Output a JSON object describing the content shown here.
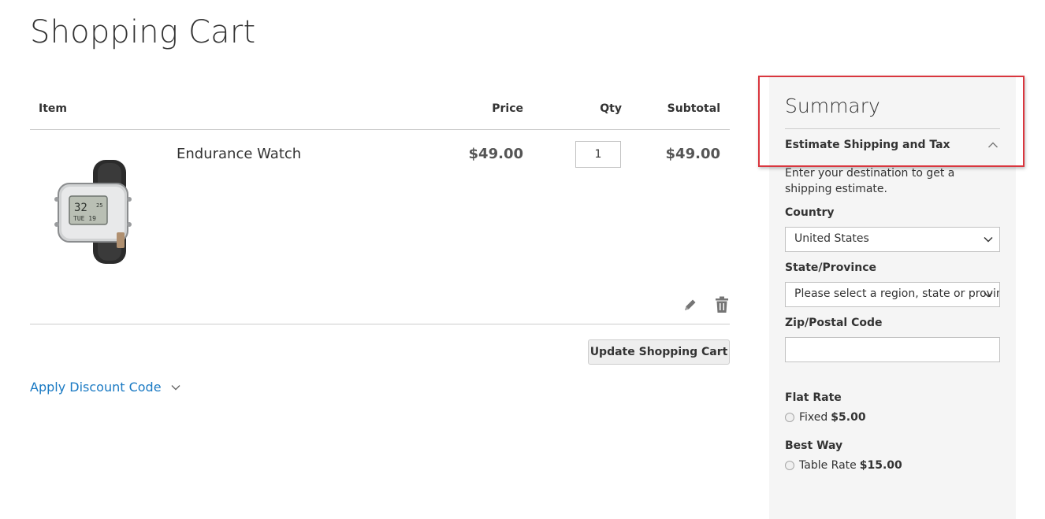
{
  "page": {
    "title": "Shopping Cart"
  },
  "cart": {
    "columns": {
      "item": "Item",
      "price": "Price",
      "qty": "Qty",
      "subtotal": "Subtotal"
    },
    "items": [
      {
        "name": "Endurance Watch",
        "price": "$49.00",
        "qty": "1",
        "subtotal": "$49.00"
      }
    ],
    "update_label": "Update Shopping Cart",
    "discount_label": "Apply Discount Code"
  },
  "summary": {
    "title": "Summary",
    "estimate_title": "Estimate Shipping and Tax",
    "estimate_note": "Enter your destination to get a shipping estimate.",
    "country_label": "Country",
    "country_value": "United States",
    "state_label": "State/Province",
    "state_value": "Please select a region, state or province.",
    "zip_label": "Zip/Postal Code",
    "zip_value": "",
    "rates": [
      {
        "carrier": "Flat Rate",
        "method": "Fixed",
        "price": "$5.00"
      },
      {
        "carrier": "Best Way",
        "method": "Table Rate",
        "price": "$15.00"
      }
    ]
  },
  "colors": {
    "link": "#1979c3",
    "highlight": "#d9363e",
    "summary_bg": "#f5f5f5"
  }
}
